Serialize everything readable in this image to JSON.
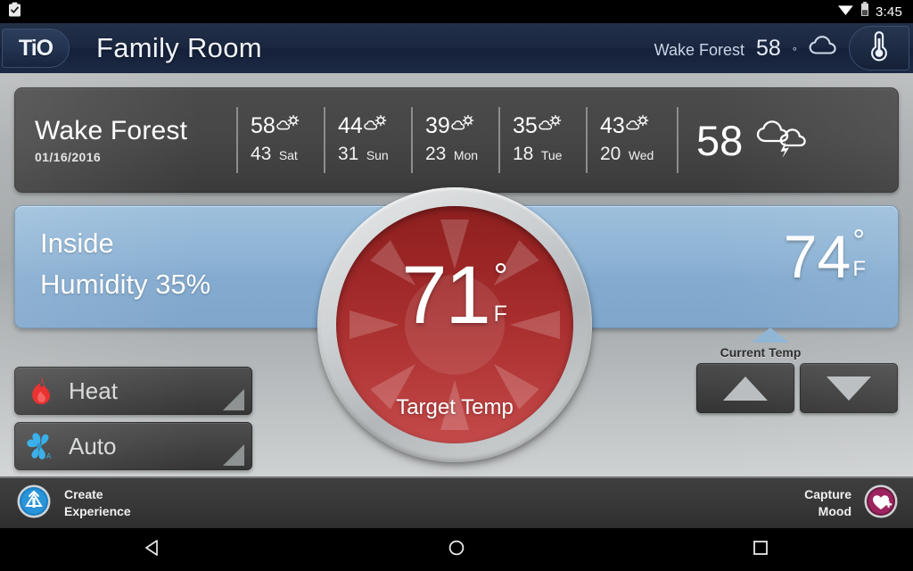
{
  "status_bar": {
    "left_icon": "clipboard-check-icon",
    "wifi_icon": "wifi-icon",
    "battery_icon": "battery-icon",
    "time": "3:45"
  },
  "app_bar": {
    "logo_text": "TiO",
    "title": "Family Room",
    "weather_city": "Wake Forest",
    "weather_temp": "58",
    "weather_degree": "°",
    "weather_icon": "cloud-icon",
    "thermostat_button_icon": "thermometer-icon"
  },
  "forecast": {
    "city": "Wake Forest",
    "date": "01/16/2016",
    "days": [
      {
        "high": "58",
        "low": "43",
        "day": "Sat",
        "icon": "partly-cloudy-icon"
      },
      {
        "high": "44",
        "low": "31",
        "day": "Sun",
        "icon": "partly-cloudy-icon"
      },
      {
        "high": "39",
        "low": "23",
        "day": "Mon",
        "icon": "partly-cloudy-icon"
      },
      {
        "high": "35",
        "low": "18",
        "day": "Tue",
        "icon": "partly-cloudy-icon"
      },
      {
        "high": "43",
        "low": "20",
        "day": "Wed",
        "icon": "partly-cloudy-icon"
      }
    ],
    "current_temp": "58",
    "current_icon": "thunderstorm-cloud-icon"
  },
  "inside_panel": {
    "line1": "Inside",
    "line2": "Humidity 35%",
    "current_temp_value": "74",
    "current_temp_degree": "°",
    "current_temp_unit": "F",
    "current_temp_label": "Current Temp"
  },
  "stepper": {
    "up_icon": "triangle-up-icon",
    "down_icon": "triangle-down-icon"
  },
  "dial": {
    "target_value": "71",
    "degree": "°",
    "unit": "F",
    "caption": "Target Temp",
    "background_icon": "sun-rays-icon"
  },
  "modes": [
    {
      "label": "Heat",
      "icon": "flame-icon",
      "icon_color": "#e8201f"
    },
    {
      "label": "Auto",
      "icon": "fan-icon",
      "icon_color": "#29a9e8"
    }
  ],
  "bottom_bar": {
    "create_icon": "create-experience-icon",
    "create_line1": "Create",
    "create_line2": "Experience",
    "capture_line1": "Capture",
    "capture_line2": "Mood",
    "capture_icon": "heart-plus-icon"
  },
  "nav_bar": {
    "back_icon": "back-triangle-icon",
    "home_icon": "home-circle-icon",
    "recents_icon": "recents-square-icon"
  },
  "colors": {
    "header_blue": "#1b2740",
    "panel_blue": "#86aed1",
    "dial_red": "#a62b2b",
    "accent_red": "#e8201f",
    "accent_blue": "#29a9e8",
    "mood_magenta": "#8e2153",
    "body_grey": "#a8acae"
  }
}
